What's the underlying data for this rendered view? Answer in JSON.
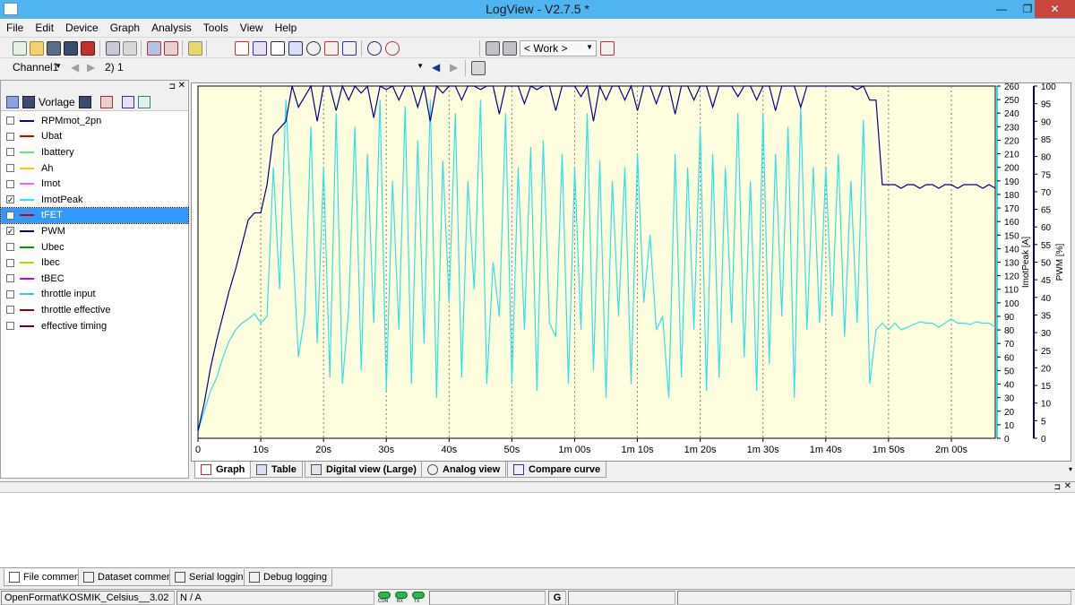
{
  "window": {
    "title": "LogView - V2.7.5 *",
    "minimize": "—",
    "restore": "❐",
    "close": "✕"
  },
  "menu": [
    "File",
    "Edit",
    "Device",
    "Graph",
    "Analysis",
    "Tools",
    "View",
    "Help"
  ],
  "toolbar": {
    "workspace": "< Work >"
  },
  "channel_bar": {
    "channel": "Channel1",
    "dataset": "2) 1"
  },
  "left_panel": {
    "preset_label": "Vorlage",
    "channels": [
      {
        "label": "RPMmot_2pn",
        "checked": false,
        "color": "#0000a0"
      },
      {
        "label": "Ubat",
        "checked": false,
        "color": "#cc0000"
      },
      {
        "label": "Ibattery",
        "checked": false,
        "color": "#66ee66"
      },
      {
        "label": "Ah",
        "checked": false,
        "color": "#ffcc00"
      },
      {
        "label": "Imot",
        "checked": false,
        "color": "#ee66ee"
      },
      {
        "label": "ImotPeak",
        "checked": true,
        "color": "#33e0e8"
      },
      {
        "label": "tFET",
        "checked": false,
        "color": "#cc0000",
        "selected": true
      },
      {
        "label": "PWM",
        "checked": true,
        "color": "#00008b"
      },
      {
        "label": "Ubec",
        "checked": false,
        "color": "#009900"
      },
      {
        "label": "Ibec",
        "checked": false,
        "color": "#cccc00"
      },
      {
        "label": "tBEC",
        "checked": false,
        "color": "#cc00cc"
      },
      {
        "label": "throttle input",
        "checked": false,
        "color": "#33cccc"
      },
      {
        "label": "throttle effective",
        "checked": false,
        "color": "#990000"
      },
      {
        "label": "effective timing",
        "checked": false,
        "color": "#660033"
      }
    ]
  },
  "chart_data": {
    "type": "line",
    "xlabel": "",
    "x_ticks": [
      "0",
      "10s",
      "20s",
      "30s",
      "40s",
      "50s",
      "1m 00s",
      "1m 10s",
      "1m 20s",
      "1m 30s",
      "1m 40s",
      "1m 50s",
      "2m 00s"
    ],
    "xlim": [
      0,
      127
    ],
    "y_axes": [
      {
        "label": "ImotPeak [A]",
        "ticks": [
          0,
          10,
          20,
          30,
          40,
          50,
          60,
          70,
          80,
          90,
          100,
          110,
          120,
          130,
          140,
          150,
          160,
          170,
          180,
          190,
          200,
          210,
          220,
          230,
          240,
          250,
          260
        ],
        "ylim": [
          0,
          260
        ]
      },
      {
        "label": "PWM [%]",
        "ticks": [
          0,
          5,
          10,
          15,
          20,
          25,
          30,
          35,
          40,
          45,
          50,
          55,
          60,
          65,
          70,
          75,
          80,
          85,
          90,
          95,
          100
        ],
        "ylim": [
          0,
          100
        ]
      }
    ],
    "grid": true,
    "background": "#ffffe0",
    "series": [
      {
        "name": "ImotPeak",
        "axis": "ImotPeak [A]",
        "color": "#33e0e8",
        "x": [
          0,
          1,
          2,
          3,
          4,
          5,
          6,
          7,
          8,
          9,
          10,
          11,
          12,
          13,
          14,
          15,
          16,
          17,
          18,
          19,
          20,
          21,
          22,
          23,
          24,
          25,
          26,
          27,
          28,
          29,
          30,
          31,
          32,
          33,
          34,
          35,
          36,
          37,
          38,
          39,
          40,
          41,
          42,
          43,
          44,
          45,
          46,
          47,
          48,
          49,
          50,
          51,
          52,
          53,
          54,
          55,
          56,
          57,
          58,
          59,
          60,
          61,
          62,
          63,
          64,
          65,
          66,
          67,
          68,
          69,
          70,
          71,
          72,
          73,
          74,
          75,
          76,
          77,
          78,
          79,
          80,
          81,
          82,
          83,
          84,
          85,
          86,
          87,
          88,
          89,
          90,
          91,
          92,
          93,
          94,
          95,
          96,
          97,
          98,
          99,
          100,
          101,
          102,
          103,
          104,
          105,
          106,
          107,
          108,
          109,
          110,
          111,
          112,
          113,
          114,
          115,
          116,
          117,
          118,
          119,
          120,
          121,
          122,
          123,
          124,
          125,
          126,
          127
        ],
        "y": [
          5,
          20,
          35,
          45,
          60,
          72,
          80,
          85,
          88,
          92,
          85,
          90,
          200,
          110,
          250,
          150,
          60,
          90,
          230,
          70,
          200,
          45,
          240,
          40,
          95,
          230,
          50,
          210,
          85,
          250,
          35,
          190,
          80,
          245,
          40,
          220,
          70,
          250,
          30,
          205,
          100,
          240,
          45,
          190,
          110,
          250,
          40,
          130,
          90,
          240,
          40,
          200,
          80,
          215,
          35,
          220,
          85,
          75,
          210,
          40,
          200,
          80,
          240,
          50,
          205,
          30,
          190,
          90,
          200,
          40,
          210,
          100,
          150,
          80,
          90,
          30,
          210,
          45,
          200,
          80,
          230,
          35,
          210,
          45,
          200,
          85,
          240,
          60,
          190,
          35,
          240,
          55,
          210,
          90,
          230,
          30,
          245,
          80,
          200,
          85,
          200,
          90,
          210,
          75,
          190,
          85,
          235,
          40,
          80,
          85,
          80,
          85,
          80,
          82,
          84,
          86,
          85,
          85,
          82,
          85,
          88,
          85,
          85,
          84,
          86,
          85,
          85,
          82
        ]
      },
      {
        "name": "PWM",
        "axis": "PWM [%]",
        "color": "#00008b",
        "x": [
          0,
          1,
          2,
          3,
          4,
          5,
          6,
          7,
          8,
          9,
          10,
          11,
          12,
          13,
          14,
          15,
          16,
          17,
          18,
          19,
          20,
          21,
          22,
          23,
          24,
          25,
          26,
          27,
          28,
          29,
          30,
          31,
          32,
          33,
          34,
          35,
          36,
          37,
          38,
          39,
          40,
          41,
          42,
          43,
          44,
          45,
          46,
          47,
          48,
          49,
          50,
          51,
          52,
          53,
          54,
          55,
          56,
          57,
          58,
          59,
          60,
          61,
          62,
          63,
          64,
          65,
          66,
          67,
          68,
          69,
          70,
          71,
          72,
          73,
          74,
          75,
          76,
          77,
          78,
          79,
          80,
          81,
          82,
          83,
          84,
          85,
          86,
          87,
          88,
          89,
          90,
          91,
          92,
          93,
          94,
          95,
          96,
          97,
          98,
          99,
          100,
          101,
          102,
          103,
          104,
          105,
          106,
          107,
          108,
          109,
          110,
          111,
          112,
          113,
          114,
          115,
          116,
          117,
          118,
          119,
          120,
          121,
          122,
          123,
          124,
          125,
          126,
          127
        ],
        "y": [
          2,
          10,
          20,
          28,
          35,
          42,
          48,
          55,
          62,
          64,
          64,
          72,
          86,
          88,
          90,
          100,
          94,
          97,
          100,
          90,
          100,
          100,
          93,
          100,
          96,
          100,
          98,
          100,
          91,
          100,
          99,
          100,
          96,
          100,
          100,
          94,
          100,
          90,
          100,
          98,
          100,
          100,
          96,
          100,
          100,
          99,
          100,
          100,
          92,
          100,
          100,
          100,
          95,
          100,
          99,
          100,
          100,
          93,
          100,
          100,
          100,
          97,
          100,
          90,
          100,
          96,
          100,
          100,
          96,
          100,
          93,
          100,
          100,
          95,
          100,
          100,
          92,
          100,
          100,
          96,
          100,
          100,
          94,
          100,
          100,
          100,
          97,
          100,
          100,
          96,
          100,
          100,
          93,
          100,
          100,
          100,
          94,
          100,
          100,
          100,
          100,
          100,
          100,
          100,
          100,
          99,
          100,
          96,
          96,
          72,
          72,
          72,
          71,
          72,
          72,
          71,
          72,
          72,
          71,
          72,
          72,
          71,
          72,
          72,
          72,
          71,
          72,
          71
        ]
      }
    ]
  },
  "graph_tabs": [
    "Graph",
    "Table",
    "Digital view (Large)",
    "Analog view",
    "Compare curve"
  ],
  "bottom_tabs": [
    "File comment",
    "Dataset comment",
    "Serial logging",
    "Debug logging"
  ],
  "status": {
    "format": "OpenFormat\\KOSMIK_Celsius__3.02",
    "value": "N / A",
    "leds": [
      "CON",
      "RX",
      "TX"
    ],
    "mode": "G"
  }
}
